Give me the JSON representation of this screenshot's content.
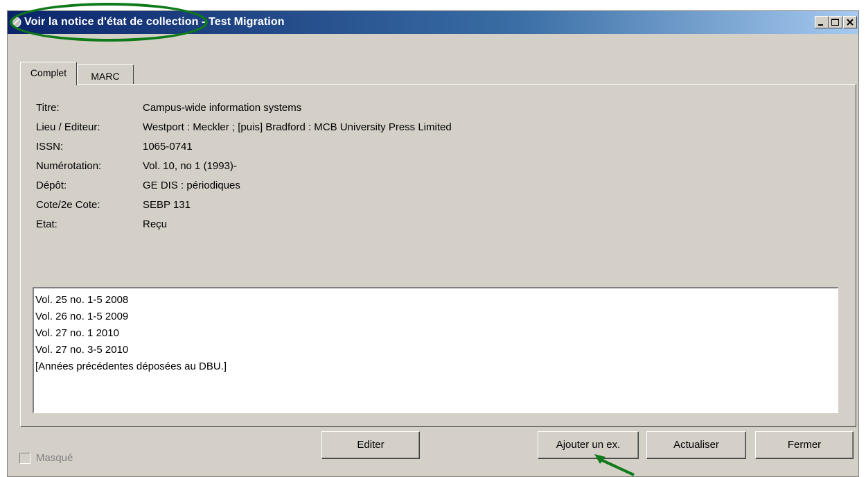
{
  "window": {
    "title": "Voir la notice d'état de collection - Test Migration",
    "controls": [
      "minimize-icon",
      "maximize-icon",
      "close-icon"
    ]
  },
  "tabs": [
    {
      "label": "Complet",
      "active": true
    },
    {
      "label": "MARC",
      "active": false
    }
  ],
  "record": {
    "fields": [
      {
        "label": "Titre:",
        "value": "Campus-wide information systems"
      },
      {
        "label": "Lieu / Editeur:",
        "value": "Westport : Meckler ; [puis] Bradford : MCB University Press Limited"
      },
      {
        "label": "ISSN:",
        "value": "1065-0741"
      },
      {
        "label": "Numérotation:",
        "value": "Vol. 10, no 1 (1993)-"
      },
      {
        "label": "Dépôt:",
        "value": "GE DIS : périodiques"
      },
      {
        "label": "Cote/2e Cote:",
        "value": "SEBP 131"
      },
      {
        "label": "Etat:",
        "value": "Reçu"
      }
    ]
  },
  "holdings": [
    "Vol. 25 no. 1-5   2008",
    "Vol. 26 no. 1-5   2009",
    "Vol. 27 no. 1   2010",
    "Vol. 27 no. 3-5   2010",
    "[Années précédentes déposées au DBU.]"
  ],
  "footer": {
    "masque_label": "Masqué",
    "masque_checked": false,
    "buttons": {
      "edit": "Editer",
      "add_copy": "Ajouter un ex.",
      "refresh": "Actualiser",
      "close": "Fermer"
    }
  },
  "annotation_color": "#0f7a1a"
}
